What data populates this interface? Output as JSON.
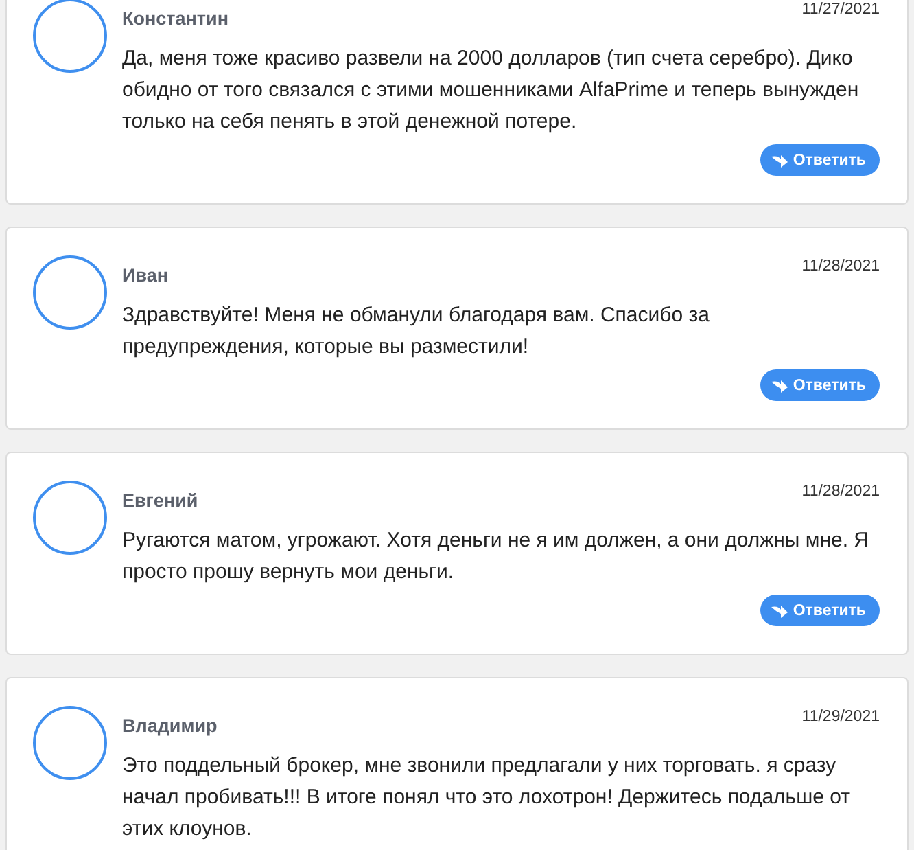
{
  "comments": [
    {
      "author": "Константин",
      "date": "11/27/2021",
      "text": "Да, меня тоже красиво развели на 2000 долларов (тип счета серебро). Дико обидно от того связался с этими мошенниками AlfaPrime и теперь вынужден только на себя пенять в этой денежной потере.",
      "reply": "Ответить"
    },
    {
      "author": "Иван",
      "date": "11/28/2021",
      "text": "Здравствуйте! Меня не обманули благодаря вам. Спасибо за предупреждения, которые вы разместили!",
      "reply": "Ответить"
    },
    {
      "author": "Евгений",
      "date": "11/28/2021",
      "text": "Ругаются матом, угрожают. Хотя деньги не я им должен, а они должны мне. Я просто прошу вернуть мои деньги.",
      "reply": "Ответить"
    },
    {
      "author": "Владимир",
      "date": "11/29/2021",
      "text": "Это поддельный брокер, мне звонили предлагали у них торговать. я сразу начал пробивать!!! В итоге понял что это лохотрон! Держитесь подальше от этих клоунов."
    }
  ]
}
